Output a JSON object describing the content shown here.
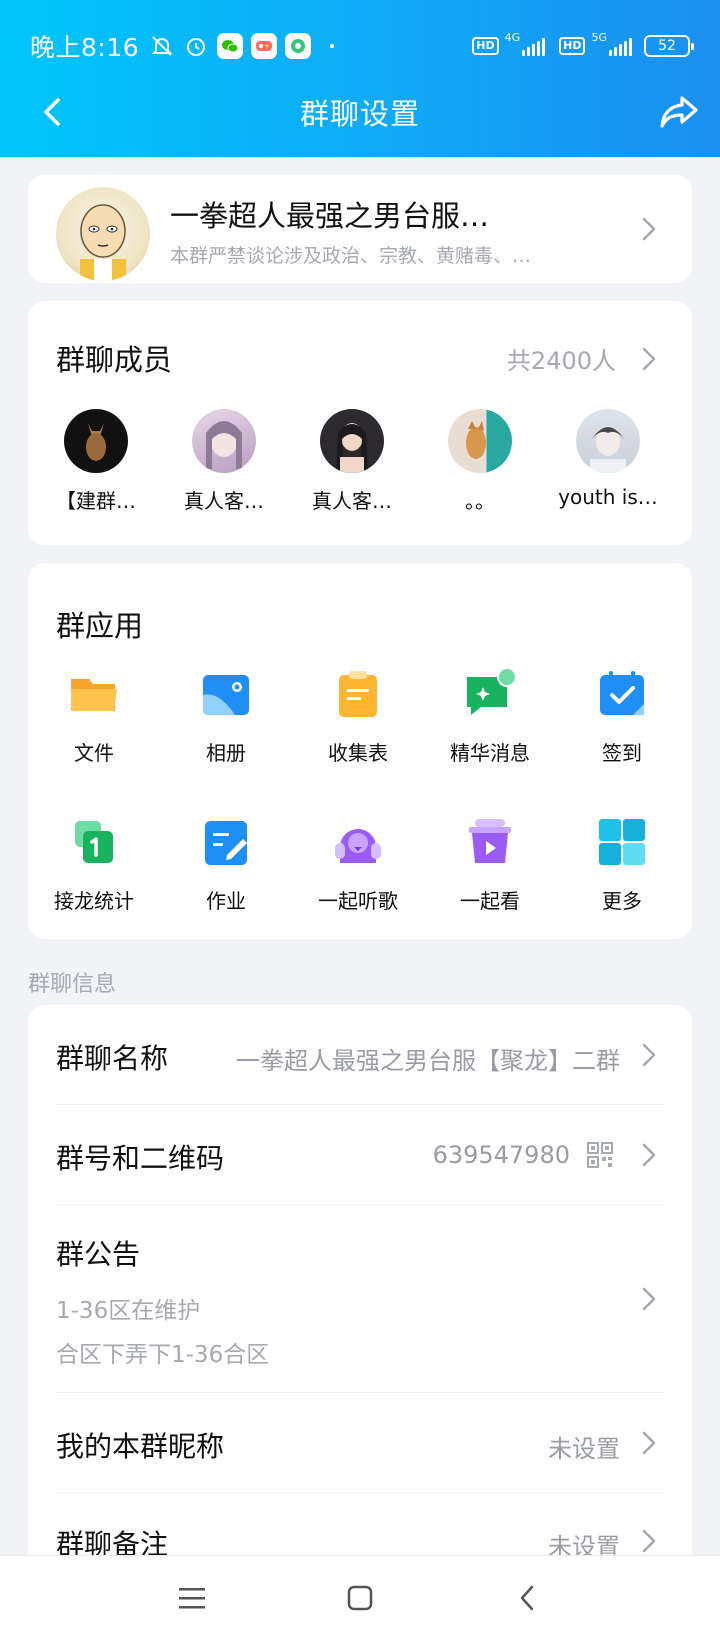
{
  "status_bar": {
    "time": "晚上8:16",
    "hd1": "HD",
    "net1": "4G",
    "hd2": "HD",
    "net2": "5G",
    "battery": "52"
  },
  "nav": {
    "title": "群聊设置"
  },
  "group": {
    "name": "一拳超人最强之男台服…",
    "description": "本群严禁谈论涉及政治、宗教、黄赌毒、…"
  },
  "members": {
    "title": "群聊成员",
    "count": "共2400人",
    "list": [
      {
        "name": "【建群…"
      },
      {
        "name": "真人客…"
      },
      {
        "name": "真人客…"
      },
      {
        "name": "。。"
      },
      {
        "name": "youth is…"
      }
    ]
  },
  "apps": {
    "title": "群应用",
    "items": [
      {
        "label": "文件",
        "icon": "folder-icon"
      },
      {
        "label": "相册",
        "icon": "album-icon"
      },
      {
        "label": "收集表",
        "icon": "clipboard-icon"
      },
      {
        "label": "精华消息",
        "icon": "essence-message-icon"
      },
      {
        "label": "签到",
        "icon": "calendar-check-icon"
      },
      {
        "label": "接龙统计",
        "icon": "relay-count-icon"
      },
      {
        "label": "作业",
        "icon": "homework-icon"
      },
      {
        "label": "一起听歌",
        "icon": "listen-together-icon"
      },
      {
        "label": "一起看",
        "icon": "watch-together-icon"
      },
      {
        "label": "更多",
        "icon": "grid-more-icon"
      }
    ]
  },
  "info": {
    "section_label": "群聊信息",
    "name_label": "群聊名称",
    "name_value": "一拳超人最强之男台服【聚龙】二群",
    "number_label": "群号和二维码",
    "number_value": "639547980",
    "announcement_label": "群公告",
    "announcement_line1": "1-36区在维护",
    "announcement_line2": "合区下弄下1-36合区",
    "nickname_label": "我的本群昵称",
    "nickname_value": "未设置",
    "remark_label": "群聊备注",
    "remark_value": "未设置"
  },
  "colors": {
    "header_start": "#00c6fb",
    "header_end": "#1a8ff0",
    "background": "#f2f3f7"
  }
}
